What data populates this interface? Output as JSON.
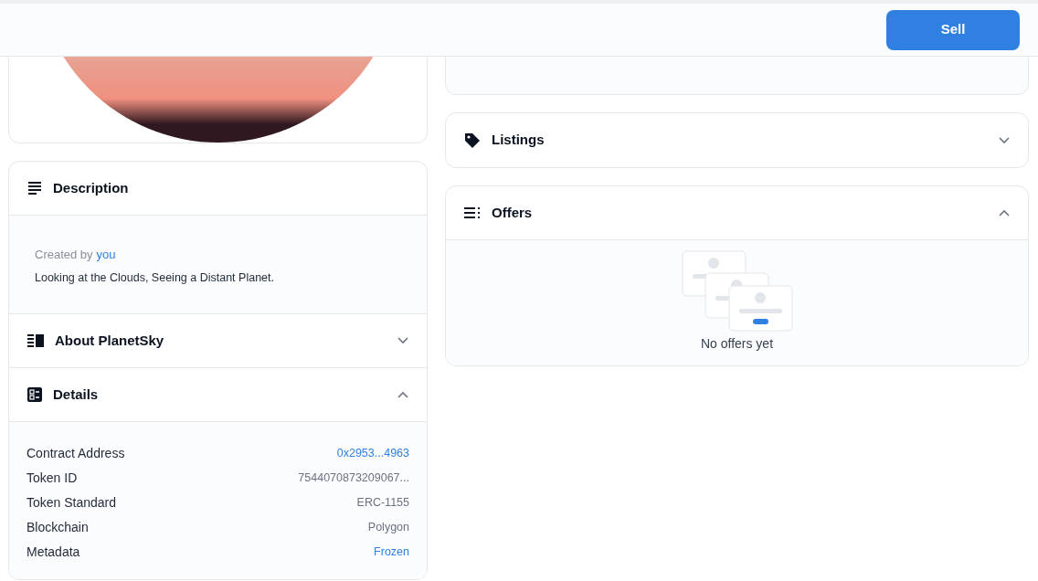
{
  "header": {
    "sell_button": "Sell"
  },
  "description": {
    "title": "Description",
    "created_by": "Created by",
    "creator": "you",
    "text": "Looking at the Clouds, Seeing a Distant Planet."
  },
  "left_sections": [
    {
      "title": "About PlanetSky",
      "expanded": false
    },
    {
      "title": "Details",
      "expanded": true
    }
  ],
  "details": [
    {
      "label": "Contract Address",
      "value": "0x2953...4963",
      "link": true
    },
    {
      "label": "Token ID",
      "value": "7544070873209067...",
      "link": false
    },
    {
      "label": "Token Standard",
      "value": "ERC-1155",
      "link": false
    },
    {
      "label": "Blockchain",
      "value": "Polygon",
      "link": false
    },
    {
      "label": "Metadata",
      "value": "Frozen",
      "link": true
    }
  ],
  "right_sections": [
    {
      "title": "Listings",
      "expanded": false
    },
    {
      "title": "Offers",
      "expanded": true
    }
  ],
  "offers_empty": "No offers yet"
}
